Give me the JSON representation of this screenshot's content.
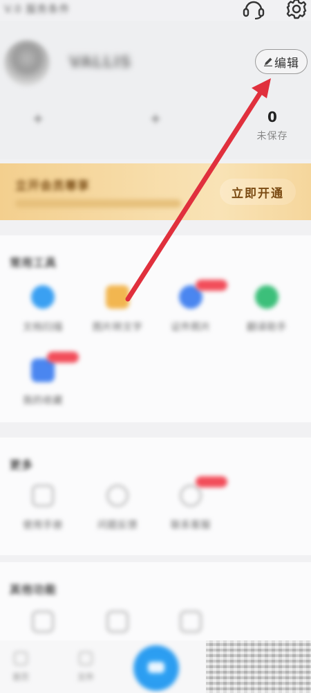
{
  "top_bar": {
    "title": "V.0 服务条件",
    "headset_icon": "headset-icon",
    "settings_icon": "gear-icon"
  },
  "profile": {
    "username": "VALLIS",
    "edit_label": "编辑",
    "stats": [
      {
        "value": "0",
        "label": "未保存"
      }
    ]
  },
  "vip_banner": {
    "title": "立开会员尊享",
    "button_label": "立即开通",
    "colors": {
      "gradient_start": "#f3cf8e",
      "gradient_end": "#f9e3b6",
      "text": "#7a4d16"
    }
  },
  "section_one": {
    "title": "常用工具",
    "tiles": [
      {
        "label": "文档扫描",
        "color": "#3aa0f2"
      },
      {
        "label": "图片转文字",
        "color": "#f2b650"
      },
      {
        "label": "证件照片",
        "color": "#4a86f0"
      },
      {
        "label": "翻译助手",
        "color": "#3cbf7a"
      },
      {
        "label": "我的收藏",
        "color": "#4a86f0"
      }
    ]
  },
  "section_two": {
    "title": "更多",
    "tiles": [
      {
        "label": "使用手册"
      },
      {
        "label": "问题反馈"
      },
      {
        "label": "联系客服"
      }
    ]
  },
  "section_three": {
    "title": "其他功能"
  },
  "bottom_nav": {
    "items": [
      {
        "label": "首页"
      },
      {
        "label": "文件"
      }
    ],
    "accent": "#2b9cf0"
  },
  "annotation": {
    "arrow_color": "#e0303d"
  }
}
